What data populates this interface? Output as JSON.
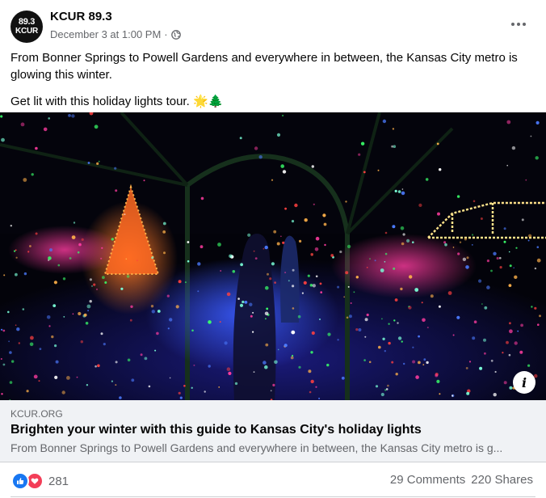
{
  "header": {
    "page_name": "KCUR 89.3",
    "avatar_line1": "89.3",
    "avatar_line2": "KCUR",
    "timestamp": "December 3 at 1:00 PM",
    "separator": "·",
    "audience_icon": "globe-icon",
    "more_icon": "more-horizontal-icon"
  },
  "post": {
    "text_1": "From Bonner Springs to Powell Gardens and everywhere in between, the Kansas City metro is glowing this winter.",
    "text_2": "Get lit with this holiday lights tour. 🌟🌲"
  },
  "image": {
    "info_label": "i",
    "info_icon": "info-icon"
  },
  "link_preview": {
    "domain": "KCUR.ORG",
    "title": "Brighten your winter with this guide to Kansas City's holiday lights",
    "description": "From Bonner Springs to Powell Gardens and everywhere in between, the Kansas City metro is g..."
  },
  "footer": {
    "reaction_icons": [
      "like-icon",
      "love-icon"
    ],
    "reaction_count": "281",
    "comments": "29 Comments",
    "shares": "220 Shares"
  },
  "colors": {
    "like_blue": "#1877f2",
    "love_red": "#f33e58",
    "secondary_text": "#65676b",
    "link_box_bg": "#f0f2f5"
  }
}
